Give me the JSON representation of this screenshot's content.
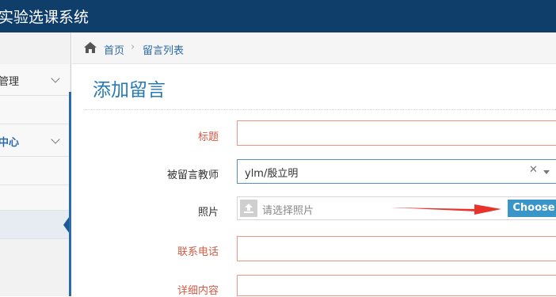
{
  "header": {
    "app_title": "实验选课系统"
  },
  "sidebar": {
    "items": [
      {
        "label": "管理",
        "expandable": true
      },
      {
        "label": ""
      },
      {
        "label": "中心",
        "expandable": true
      },
      {
        "label": ""
      },
      {
        "label": ""
      },
      {
        "label": ""
      }
    ]
  },
  "breadcrumb": {
    "home": "首页",
    "separator": "›",
    "current": "留言列表"
  },
  "page": {
    "title": "添加留言"
  },
  "form": {
    "title_label": "标题",
    "teacher_label": "被留言教师",
    "teacher_value": "ylm/殷立明",
    "photo_label": "照片",
    "photo_placeholder": "请选择照片",
    "choose_label": "Choose",
    "phone_label": "联系电话",
    "detail_label": "详细内容"
  },
  "colors": {
    "header_bg": "#0f3e6b",
    "accent": "#2679b5",
    "required_label": "#d15b47",
    "choose_button": "#3a95c8",
    "annotation_arrow": "#e8332a"
  },
  "icons": {
    "home": "home-icon",
    "upload": "upload-icon",
    "clear": "clear-icon",
    "dropdown": "caret-down-icon"
  }
}
